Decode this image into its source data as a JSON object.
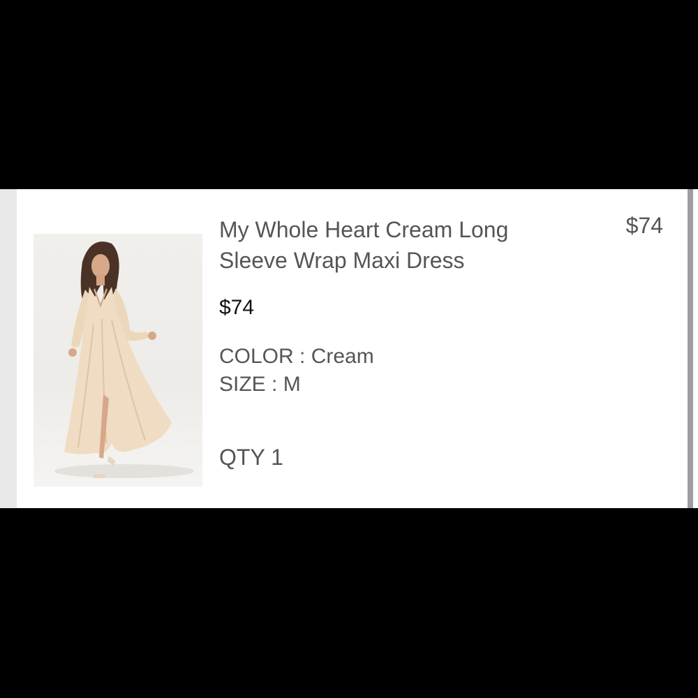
{
  "item": {
    "title": "My Whole Heart Cream Long Sleeve Wrap Maxi Dress",
    "line_price": "$74",
    "unit_price": "$74",
    "color_label": "COLOR",
    "color_value": "Cream",
    "size_label": "SIZE",
    "size_value": "M",
    "qty_label": "QTY",
    "qty_value": "1",
    "image_name": "product-thumbnail"
  },
  "colors": {
    "page_background": "#000000",
    "card_background": "#ffffff",
    "text_gray": "#555555",
    "price_black": "#111111",
    "dress_cream": "#efdcc2"
  }
}
